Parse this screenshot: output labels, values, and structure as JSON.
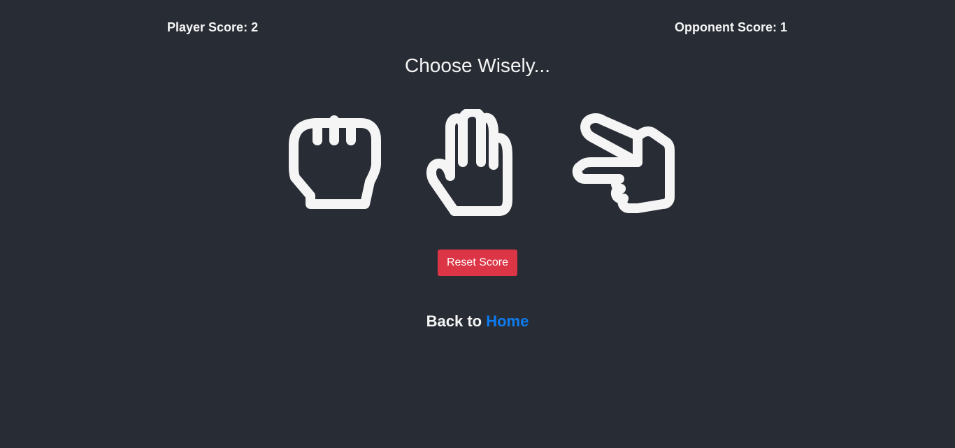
{
  "scores": {
    "player": "Player Score: 2",
    "opponent": "Opponent Score: 1"
  },
  "title": "Choose Wisely...",
  "choices": [
    {
      "name": "rock",
      "icon": "fist-icon"
    },
    {
      "name": "paper",
      "icon": "open-hand-icon"
    },
    {
      "name": "scissors",
      "icon": "scissors-hand-icon"
    }
  ],
  "reset_label": "Reset Score",
  "back": {
    "prefix": "Back to ",
    "link_label": "Home"
  },
  "colors": {
    "background": "#282c34",
    "text": "#f5f5f5",
    "reset_button": "#dc3545",
    "link": "#0d7cf2"
  }
}
